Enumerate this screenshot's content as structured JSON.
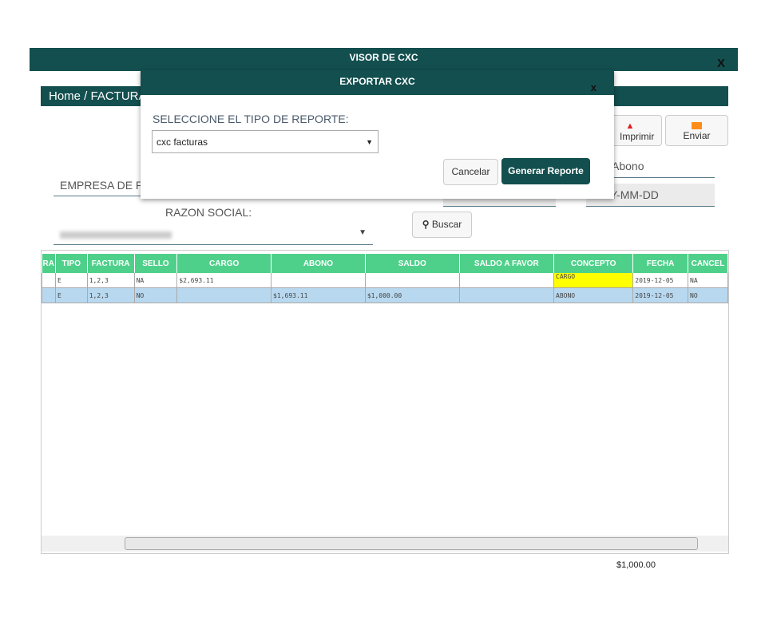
{
  "window": {
    "title": "VISOR DE CXC",
    "close": "X"
  },
  "breadcrumb": "Home / FACTURA",
  "toolbar": {
    "print": "Imprimir",
    "send": "Enviar",
    "print_icon": "pdf-icon",
    "send_icon": "envelope-icon",
    "print_icon_color": "#e31b1b",
    "send_icon_color": "#ff8c1a"
  },
  "filters": {
    "empresa_label": "EMPRESA DE PR",
    "abono_placeholder": "Abono",
    "date_placeholder": "Y-MM-DD",
    "razon_label": "RAZON SOCIAL:",
    "search": "Buscar"
  },
  "table": {
    "headers": [
      "RA",
      "TIPO",
      "FACTURA",
      "SELLO",
      "CARGO",
      "ABONO",
      "SALDO",
      "SALDO A FAVOR",
      "CONCEPTO",
      "FECHA",
      "CANCEL"
    ],
    "rows": [
      [
        "",
        "E",
        "1,2,3",
        "NA",
        "$2,693.11",
        "",
        "",
        "",
        "CARGO",
        "2019-12-05",
        "NA"
      ],
      [
        "",
        "E",
        "1,2,3",
        "NO",
        "",
        "$1,693.11",
        "$1,000.00",
        "",
        "ABONO",
        "2019-12-05",
        "NO"
      ]
    ],
    "highlight_color": "#ffff00",
    "selected_row_color": "#b8d8ef",
    "header_color": "#4fd08a"
  },
  "total": "$1,000.00",
  "modal": {
    "title": "EXPORTAR CXC",
    "close": "x",
    "label": "SELECCIONE EL TIPO DE REPORTE:",
    "select_value": "cxc facturas",
    "cancel": "Cancelar",
    "generate": "Generar Reporte"
  },
  "colors": {
    "primary": "#134f4f"
  }
}
